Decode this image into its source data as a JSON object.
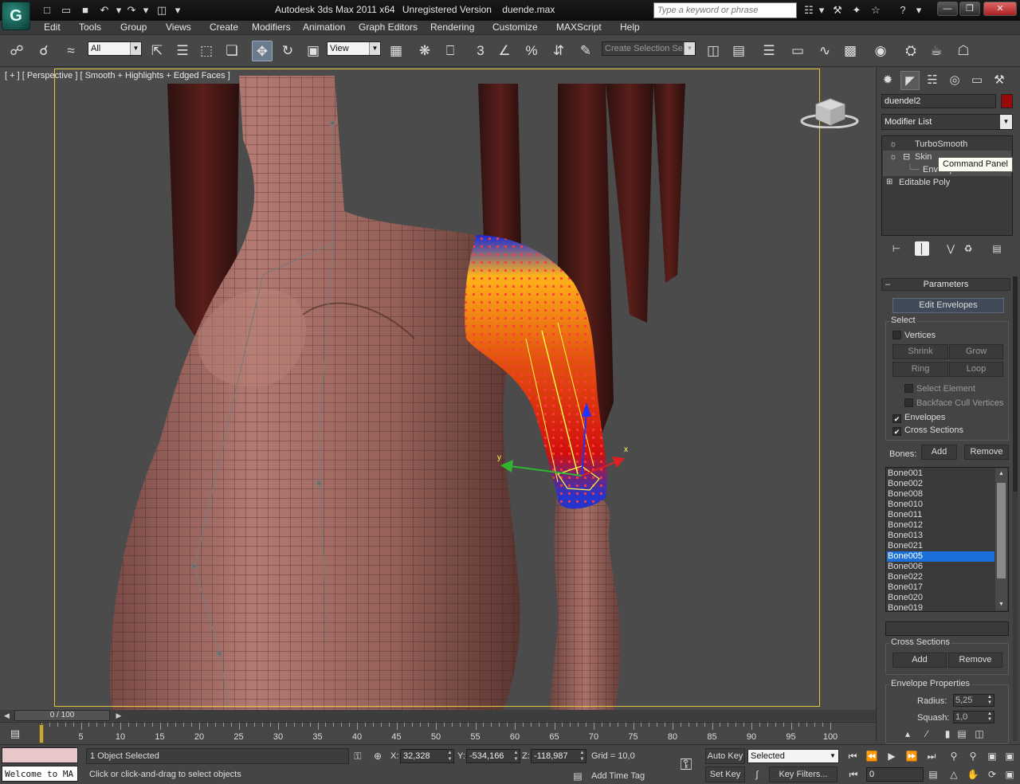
{
  "titlebar": {
    "app_name": "Autodesk 3ds Max  2011 x64",
    "version_note": "Unregistered Version",
    "file_name": "duende.max",
    "search_placeholder": "Type a keyword or phrase",
    "logo_glyph": "G"
  },
  "menu": [
    "Edit",
    "Tools",
    "Group",
    "Views",
    "Create",
    "Modifiers",
    "Animation",
    "Graph Editors",
    "Rendering",
    "Customize",
    "MAXScript",
    "Help"
  ],
  "toolbar": {
    "selection_filter": "All",
    "ref_coord": "View",
    "named_selection_placeholder": "Create Selection Se",
    "snap_label": "3",
    "percent_label": "%"
  },
  "viewport": {
    "label": "[ + ] [ Perspective ] [ Smooth + Highlights + Edged Faces ]",
    "gizmo_x": "x",
    "gizmo_y": "y"
  },
  "command_panel": {
    "tooltip": "Command Panel",
    "object_name": "duendel2",
    "object_color": "#9b0a0a",
    "modifier_list": "Modifier List",
    "stack": [
      {
        "label": "TurboSmooth",
        "indent": 1,
        "icon": "lightbulb-icon"
      },
      {
        "label": "Skin",
        "indent": 1,
        "icon": "lightbulb-icon",
        "expanded": true
      },
      {
        "label": "Envelope",
        "indent": 2,
        "selected": true
      },
      {
        "label": "Editable Poly",
        "indent": 0,
        "icon": "plus-icon"
      }
    ],
    "parameters": {
      "title": "Parameters",
      "edit_envelopes": "Edit Envelopes",
      "select_group": "Select",
      "vertices": "Vertices",
      "shrink": "Shrink",
      "grow": "Grow",
      "ring": "Ring",
      "loop": "Loop",
      "select_element": "Select Element",
      "backface_cull": "Backface Cull Vertices",
      "envelopes": "Envelopes",
      "cross_sections_check": "Cross Sections",
      "bones_label": "Bones:",
      "add": "Add",
      "remove": "Remove",
      "bones": [
        "Bone001",
        "Bone002",
        "Bone008",
        "Bone010",
        "Bone011",
        "Bone012",
        "Bone013",
        "Bone021",
        "Bone005",
        "Bone006",
        "Bone022",
        "Bone017",
        "Bone020",
        "Bone019"
      ],
      "selected_bone": "Bone005",
      "cross_sections_group": "Cross Sections",
      "cs_add": "Add",
      "cs_remove": "Remove",
      "envelope_props": "Envelope Properties",
      "radius_label": "Radius:",
      "radius_value": "5,25",
      "squash_label": "Squash:",
      "squash_value": "1,0"
    }
  },
  "timeslider": {
    "label": "0 / 100",
    "current_frame": 0,
    "frame_count": 100,
    "ticks": [
      "0",
      "5",
      "10",
      "15",
      "20",
      "25",
      "30",
      "35",
      "40",
      "45",
      "50",
      "55",
      "60",
      "65",
      "70",
      "75",
      "80",
      "85",
      "90",
      "95",
      "100"
    ]
  },
  "status": {
    "listener": "Welcome to MA",
    "selection": "1 Object Selected",
    "prompt": "Click or click-and-drag to select objects",
    "x_label": "X:",
    "x_value": "32,328",
    "y_label": "Y:",
    "y_value": "-534,166",
    "z_label": "Z:",
    "z_value": "-118,987",
    "grid": "Grid = 10,0",
    "add_time_tag": "Add Time Tag",
    "auto_key": "Auto Key",
    "set_key": "Set Key",
    "selected_dropdown": "Selected",
    "key_filters": "Key Filters...",
    "frame_value": "0"
  }
}
